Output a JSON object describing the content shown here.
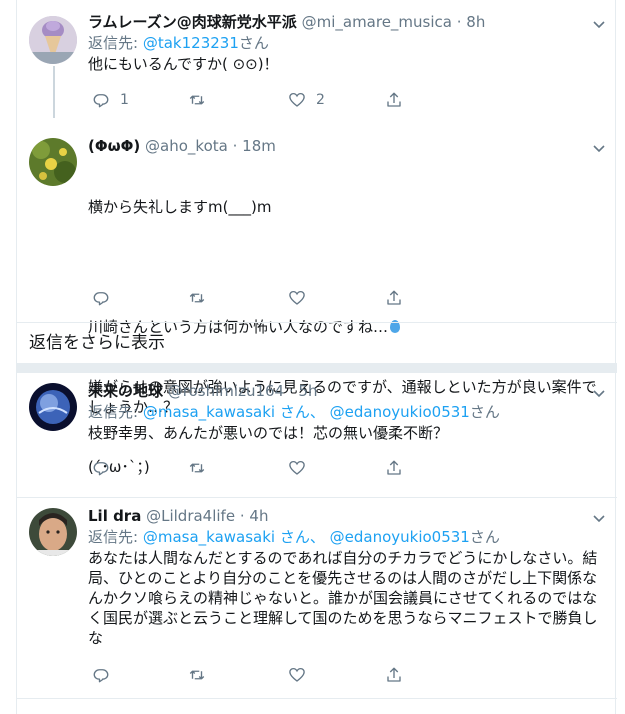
{
  "tweets": [
    {
      "name": "ラムレーズン@肉球新党水平派",
      "handle": "@mi_amare_musica",
      "time": "· 8h",
      "reply_label": "返信先:",
      "reply_to": [
        "@tak123231"
      ],
      "reply_suffix": "さん",
      "text": "他にもいるんですか( ⊙⊙)！",
      "reply_count": "1",
      "retweet_count": "",
      "like_count": "2"
    },
    {
      "name": "(ΦωΦ)",
      "handle": "@aho_kota",
      "time": "· 18m",
      "text_line1": "横から失礼しますm(___)m",
      "text_line2": "川崎さんという方は何か怖い人なのですね…",
      "text_line3": "嫌がらせの意図が強いように見えるのですが、通報しといた方が良い案件でしょうか…？",
      "text_line4": "(´･ω･`；)",
      "reply_count": "",
      "retweet_count": "",
      "like_count": ""
    },
    {
      "name": "未来の地球",
      "handle": "@roshimizu164",
      "time": "· 5h",
      "reply_label": "返信先:",
      "reply_to_1": "@masa_kawasaki さん、",
      "reply_to_2": "@edanoyukio0531",
      "reply_suffix": "さん",
      "text": "枝野幸男、あんたが悪いのでは！芯の無い優柔不断？"
    },
    {
      "name": "Lil dra",
      "handle": "@Lildra4life",
      "time": "· 4h",
      "reply_label": "返信先:",
      "reply_to_1": "@masa_kawasaki さん、",
      "reply_to_2": "@edanoyukio0531",
      "reply_suffix": "さん",
      "text": "あなたは人間なんだとするのであれば自分のチカラでどうにかしなさい。結局、ひとのことより自分のことを優先させるのは人間のさがだし上下関係なんかクソ喰らえの精神じゃないと。誰かが国会議員にさせてくれるのではなく国民が選ぶと云うこと理解して国のためを思うならマニフェストで勝負しな"
    }
  ],
  "show_more_label": "返信をさらに表示",
  "icons": {
    "reply": "reply-icon",
    "retweet": "retweet-icon",
    "like": "heart-icon",
    "share": "share-icon",
    "caret": "chevron-down-icon",
    "drop": "droplet-emoji"
  },
  "colors": {
    "link": "#1da1f2",
    "secondary": "#657786",
    "border": "#e6ecf0"
  }
}
